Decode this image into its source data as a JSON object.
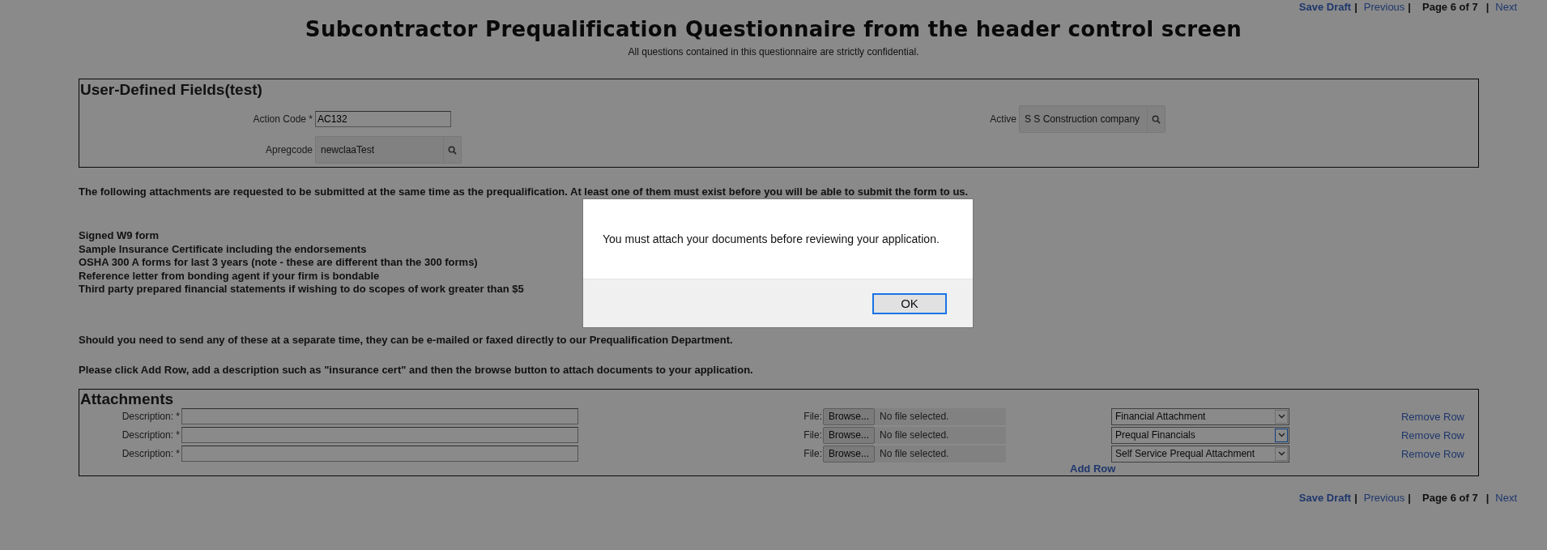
{
  "nav_top": {
    "save_draft": "Save Draft",
    "separator_1": "|",
    "previous": "Previous",
    "separator_2": "|",
    "page": "Page 6 of 7",
    "separator_3": "|",
    "next": "Next"
  },
  "title": "Subcontractor Prequalification Questionnaire from the header control screen",
  "subtitle": "All questions contained in this questionnaire are strictly confidential.",
  "user_defined_fields": {
    "heading": "User-Defined Fields(test)",
    "fields": [
      {
        "label": "Action Code *",
        "value": "AC132",
        "kind": "text"
      },
      {
        "label": "Active",
        "value": "S S Construction company",
        "kind": "lookup"
      },
      {
        "label": "Apregcode",
        "value": "newclaaTest",
        "kind": "lookup"
      }
    ]
  },
  "instructions": "The following attachments are requested to be submitted at the same time as the prequalification. At least one of them must exist before you will be able to submit the form to us.",
  "requested_documents": [
    "Signed W9 form",
    "Sample Insurance Certificate including the endorsements",
    "OSHA 300 A forms for last 3 years (note - these are different than the 300 forms)",
    "Reference letter from bonding agent if your firm is bondable",
    "Third party prepared financial statements if wishing to do scopes of work greater than $5"
  ],
  "send_note": "Should you need to send any of these at a separate time, they can be e-mailed or faxed directly to our Prequalification Department.",
  "add_row_note": "Please click Add Row, add a description such as \"insurance cert\" and then the browse button to attach documents to your application.",
  "attachments": {
    "heading": "Attachments",
    "rows": [
      {
        "description_label": "Description: *",
        "file_label": "File:",
        "browse": "Browse...",
        "file_status": "No file selected.",
        "type": "Financial Attachment",
        "focused": false,
        "remove": "Remove Row"
      },
      {
        "description_label": "Description: *",
        "file_label": "File:",
        "browse": "Browse...",
        "file_status": "No file selected.",
        "type": "Prequal Financials",
        "focused": true,
        "remove": "Remove Row"
      },
      {
        "description_label": "Description: *",
        "file_label": "File:",
        "browse": "Browse...",
        "file_status": "No file selected.",
        "type": "Self Service Prequal Attachment",
        "focused": false,
        "remove": "Remove Row"
      }
    ],
    "add_row": "Add Row"
  },
  "nav_bottom": {
    "save_draft": "Save Draft",
    "separator_1": "|",
    "previous": "Previous",
    "separator_2": "|",
    "page": "Page 6 of 7",
    "separator_3": "|",
    "next": "Next"
  },
  "dialog": {
    "message": "You must attach your documents before reviewing your application.",
    "ok": "OK"
  }
}
